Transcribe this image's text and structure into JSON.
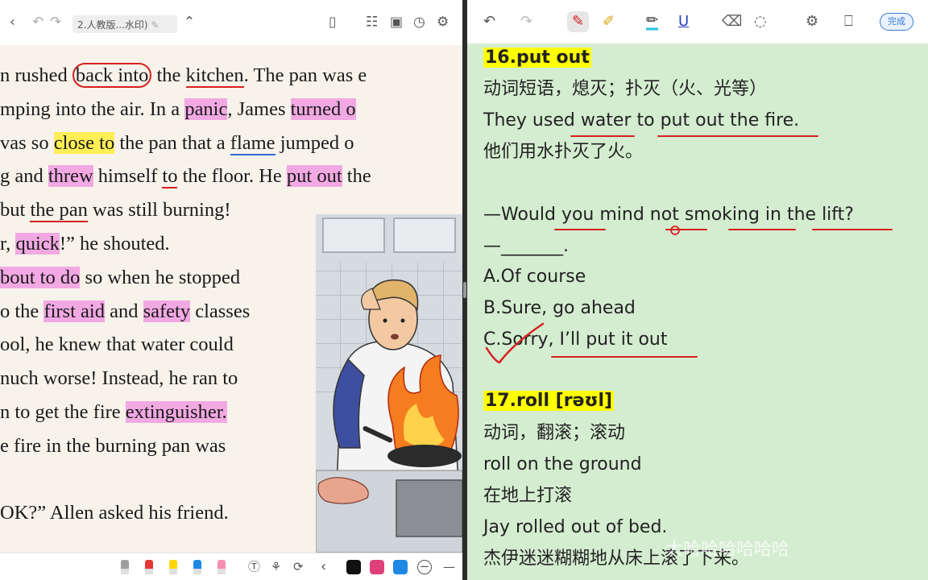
{
  "left_toolbar": {
    "back_icon": "chevron-left-icon",
    "undo_icon": "undo-icon",
    "redo_icon": "redo-icon",
    "document_title": "2.人教版...水印)",
    "edit_icon": "pencil-icon",
    "collapse_icon": "chevron-up-icon",
    "tools": [
      "page-icon",
      "text-recognize-icon",
      "camera-icon",
      "clock-icon",
      "settings-icon"
    ]
  },
  "book": {
    "lines": [
      {
        "segments": [
          {
            "t": "n rushed "
          },
          {
            "t": "back into",
            "s": "circ"
          },
          {
            "t": " the "
          },
          {
            "t": "kitchen",
            "s": "ul-red"
          },
          {
            "t": ". The pan was e"
          }
        ]
      },
      {
        "segments": [
          {
            "t": "mping into the air. In a "
          },
          {
            "t": "panic",
            "s": "hl"
          },
          {
            "t": ", James "
          },
          {
            "t": "turned o",
            "s": "hl"
          }
        ]
      },
      {
        "segments": [
          {
            "t": "vas so "
          },
          {
            "t": "close to",
            "s": "hly"
          },
          {
            "t": " the pan that a "
          },
          {
            "t": "flame",
            "s": "ul-blue"
          },
          {
            "t": " jumped o"
          }
        ]
      },
      {
        "segments": [
          {
            "t": "g and "
          },
          {
            "t": "threw",
            "s": "hl"
          },
          {
            "t": " himself "
          },
          {
            "t": "to",
            "s": "ul-red"
          },
          {
            "t": " the floor. He "
          },
          {
            "t": "put out",
            "s": "hl"
          },
          {
            "t": " the"
          }
        ]
      },
      {
        "segments": [
          {
            "t": "but "
          },
          {
            "t": "the pan",
            "s": "ul-red"
          },
          {
            "t": " was still burning!"
          }
        ]
      },
      {
        "segments": [
          {
            "t": "r, "
          },
          {
            "t": "quick",
            "s": "hl"
          },
          {
            "t": "!” he shouted."
          }
        ]
      },
      {
        "segments": [
          {
            "t": "bout to do",
            "s": "hl"
          },
          {
            "t": " so when he stopped"
          }
        ]
      },
      {
        "segments": [
          {
            "t": "o the "
          },
          {
            "t": "first aid",
            "s": "hl"
          },
          {
            "t": " and "
          },
          {
            "t": "safety",
            "s": "hl"
          },
          {
            "t": " classes"
          }
        ]
      },
      {
        "segments": [
          {
            "t": "ool, he knew that water could"
          }
        ]
      },
      {
        "segments": [
          {
            "t": "nuch worse! Instead, he ran to"
          }
        ]
      },
      {
        "segments": [
          {
            "t": "n to get the fire "
          },
          {
            "t": "extinguisher.",
            "s": "hl"
          }
        ]
      },
      {
        "segments": [
          {
            "t": "e fire in the burning pan was"
          }
        ]
      },
      {
        "segments": [
          {
            "t": ""
          }
        ]
      },
      {
        "segments": [
          {
            "t": "OK?” Allen asked his friend."
          }
        ]
      }
    ]
  },
  "left_bottom_toolbar": {
    "pen_colors": [
      "#9e9e9e",
      "#e53935",
      "#ffd600",
      "#1e88e5",
      "#f48fb1"
    ],
    "tools": [
      "text-box-icon",
      "shapes-icon",
      "lasso-icon",
      "chevron-left-icon"
    ],
    "palette": [
      "#111111",
      "#e0407a",
      "#1e88e5"
    ],
    "zoom_out": "−"
  },
  "right_toolbar": {
    "tools": [
      "undo-icon",
      "redo-icon",
      "pen-icon",
      "highlighter-icon",
      "text-highlight-icon",
      "underline-icon",
      "eraser-icon",
      "lasso-icon",
      "settings-icon",
      "save-icon"
    ],
    "done_label": "完成"
  },
  "notes": {
    "item16_title": "16.put out",
    "item16_def": "动词短语，熄灭；扑灭（火、光等）",
    "item16_example": "They used water to put out the fire.",
    "item16_translation": "他们用水扑灭了火。",
    "question": "—Would you mind not smoking in the lift?",
    "answer_blank": "—_______.",
    "option_a": "A.Of course",
    "option_b": "B.Sure, go ahead",
    "option_c": "C.Sorry, I’ll put it out",
    "item17_title": "17.roll [rəʊl]",
    "item17_def": "动词，翻滚；滚动",
    "item17_example": "roll on the ground",
    "item17_translation": "在地上打滚",
    "item17_example2": "Jay rolled out of bed.",
    "item17_translation2": "杰伊迷迷糊糊地从床上滚了下来。"
  },
  "watermark": "大哈哈哈哈哈哈",
  "colors": {
    "note_bg": "#d4edd0",
    "highlight_yellow": "#ffff00",
    "highlight_pink": "#f2a9e3",
    "ink_red": "#d62020",
    "ink_blue": "#2f6fd6",
    "accent": "#3a7bd5"
  }
}
